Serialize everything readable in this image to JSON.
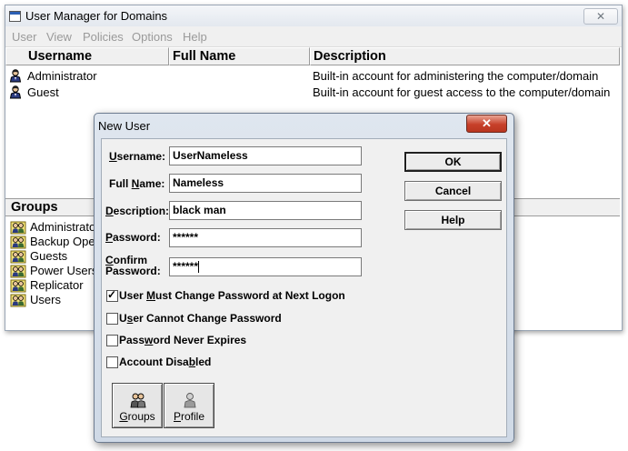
{
  "window": {
    "title": "User Manager for Domains",
    "close_glyph": "✕"
  },
  "menu": [
    "User",
    "View",
    "Policies",
    "Options",
    "Help"
  ],
  "users_table": {
    "columns": [
      "Username",
      "Full Name",
      "Description"
    ],
    "rows": [
      {
        "username": "Administrator",
        "full_name": "",
        "description": "Built-in account for administering the computer/domain",
        "icon": "user-icon"
      },
      {
        "username": "Guest",
        "full_name": "",
        "description": "Built-in account for guest access to the computer/domain",
        "icon": "user-icon"
      }
    ]
  },
  "groups": {
    "header": "Groups",
    "items": [
      "Administrators",
      "Backup Operators",
      "Guests",
      "Power Users",
      "Replicator",
      "Users"
    ],
    "icon": "group-icon"
  },
  "dialog": {
    "title": "New User",
    "close_glyph": "✕",
    "fields": {
      "username_label": "Username:",
      "username_value": "UserNameless",
      "fullname_label": "Full Name:",
      "fullname_value": "Nameless",
      "description_label": "Description:",
      "description_value": "black man",
      "password_label": "Password:",
      "password_value": "******",
      "confirm_label_1": "Confirm",
      "confirm_label_2": "Password:",
      "confirm_value": "******"
    },
    "buttons": {
      "ok": "OK",
      "cancel": "Cancel",
      "help": "Help"
    },
    "checkboxes": [
      {
        "label": "User Must Change Password at Next Logon",
        "checked": true
      },
      {
        "label": "User Cannot Change Password",
        "checked": false
      },
      {
        "label": "Password Never Expires",
        "checked": false
      },
      {
        "label": "Account Disabled",
        "checked": false
      }
    ],
    "bottom_buttons": {
      "groups": "Groups",
      "profile": "Profile"
    }
  },
  "colors": {
    "dialog_frame": "#d4dde9",
    "close_red": "#c7402a",
    "menu_disabled": "#9a9a9a"
  }
}
